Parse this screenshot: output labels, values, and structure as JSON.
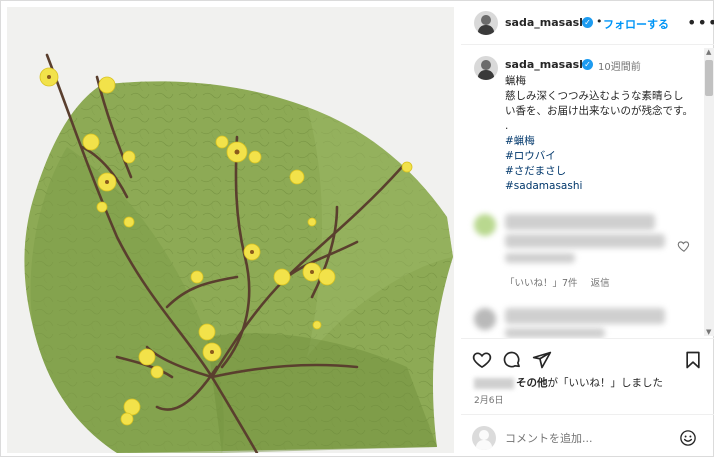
{
  "post": {
    "username": "sada_masashi",
    "separator": "•",
    "follow_label": "フォローする",
    "more_icon": "more-horizontal-icon",
    "verified_icon": "verified-badge-icon"
  },
  "caption": {
    "username": "sada_masashi",
    "time_ago": "10週間前",
    "lines": [
      "蝋梅",
      "慈しみ深くつつみ込むような素晴らしい香を、お届け出来ないのが残念です。",
      "."
    ],
    "hashtags": [
      "#蝋梅",
      "#ロウバイ",
      "#さだまさし",
      "#sadamasashi"
    ]
  },
  "comment_meta": {
    "likes": "「いいね！」7件",
    "reply": "返信"
  },
  "actions": {
    "like_icon": "heart-icon",
    "comment_icon": "comment-icon",
    "share_icon": "send-icon",
    "save_icon": "bookmark-icon"
  },
  "likes_summary": {
    "others": "その他",
    "text": "が「いいね！」しました"
  },
  "date": "2月6日",
  "comment_box": {
    "placeholder": "コメントを追加...",
    "emoji_icon": "emoji-icon"
  },
  "colors": {
    "link": "#0095f6",
    "hashtag": "#00376b",
    "verified": "#1d9bf0",
    "text": "#262626",
    "muted": "#737373"
  }
}
